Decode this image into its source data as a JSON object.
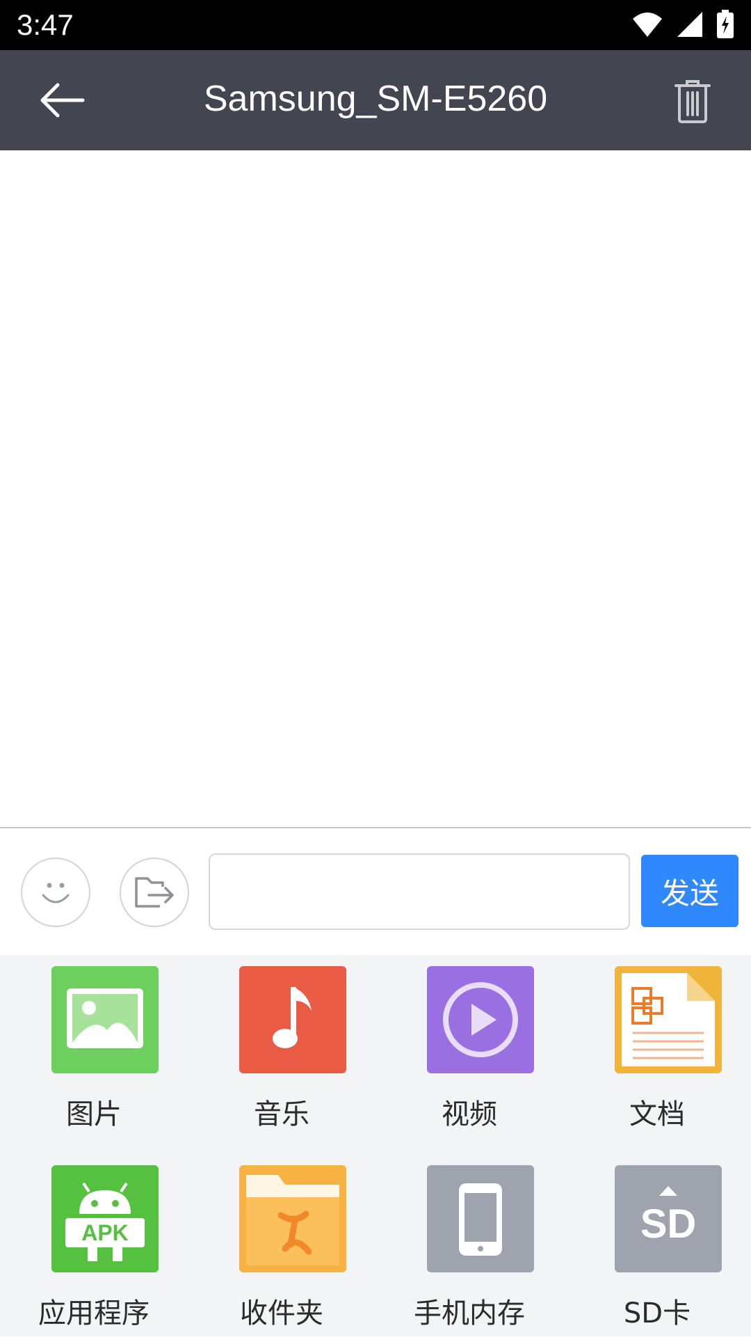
{
  "status_bar": {
    "time": "3:47"
  },
  "app_bar": {
    "title": "Samsung_SM-E5260"
  },
  "composer": {
    "input_value": "",
    "send_label": "发送"
  },
  "panel": {
    "items": [
      {
        "label": "图片",
        "icon": "image-icon",
        "color": "#6ccf5e"
      },
      {
        "label": "音乐",
        "icon": "music-icon",
        "color": "#ea5b45"
      },
      {
        "label": "视频",
        "icon": "video-icon",
        "color": "#9a6fe2"
      },
      {
        "label": "文档",
        "icon": "document-icon",
        "color": "#f1b43a"
      },
      {
        "label": "应用程序",
        "icon": "apk-icon",
        "color": "#56c041"
      },
      {
        "label": "收件夹",
        "icon": "folder-icon",
        "color": "#f7b244"
      },
      {
        "label": "手机内存",
        "icon": "phone-storage-icon",
        "color": "#9ea3ad"
      },
      {
        "label": "SD卡",
        "icon": "sd-card-icon",
        "color": "#9ea3ad"
      }
    ]
  }
}
